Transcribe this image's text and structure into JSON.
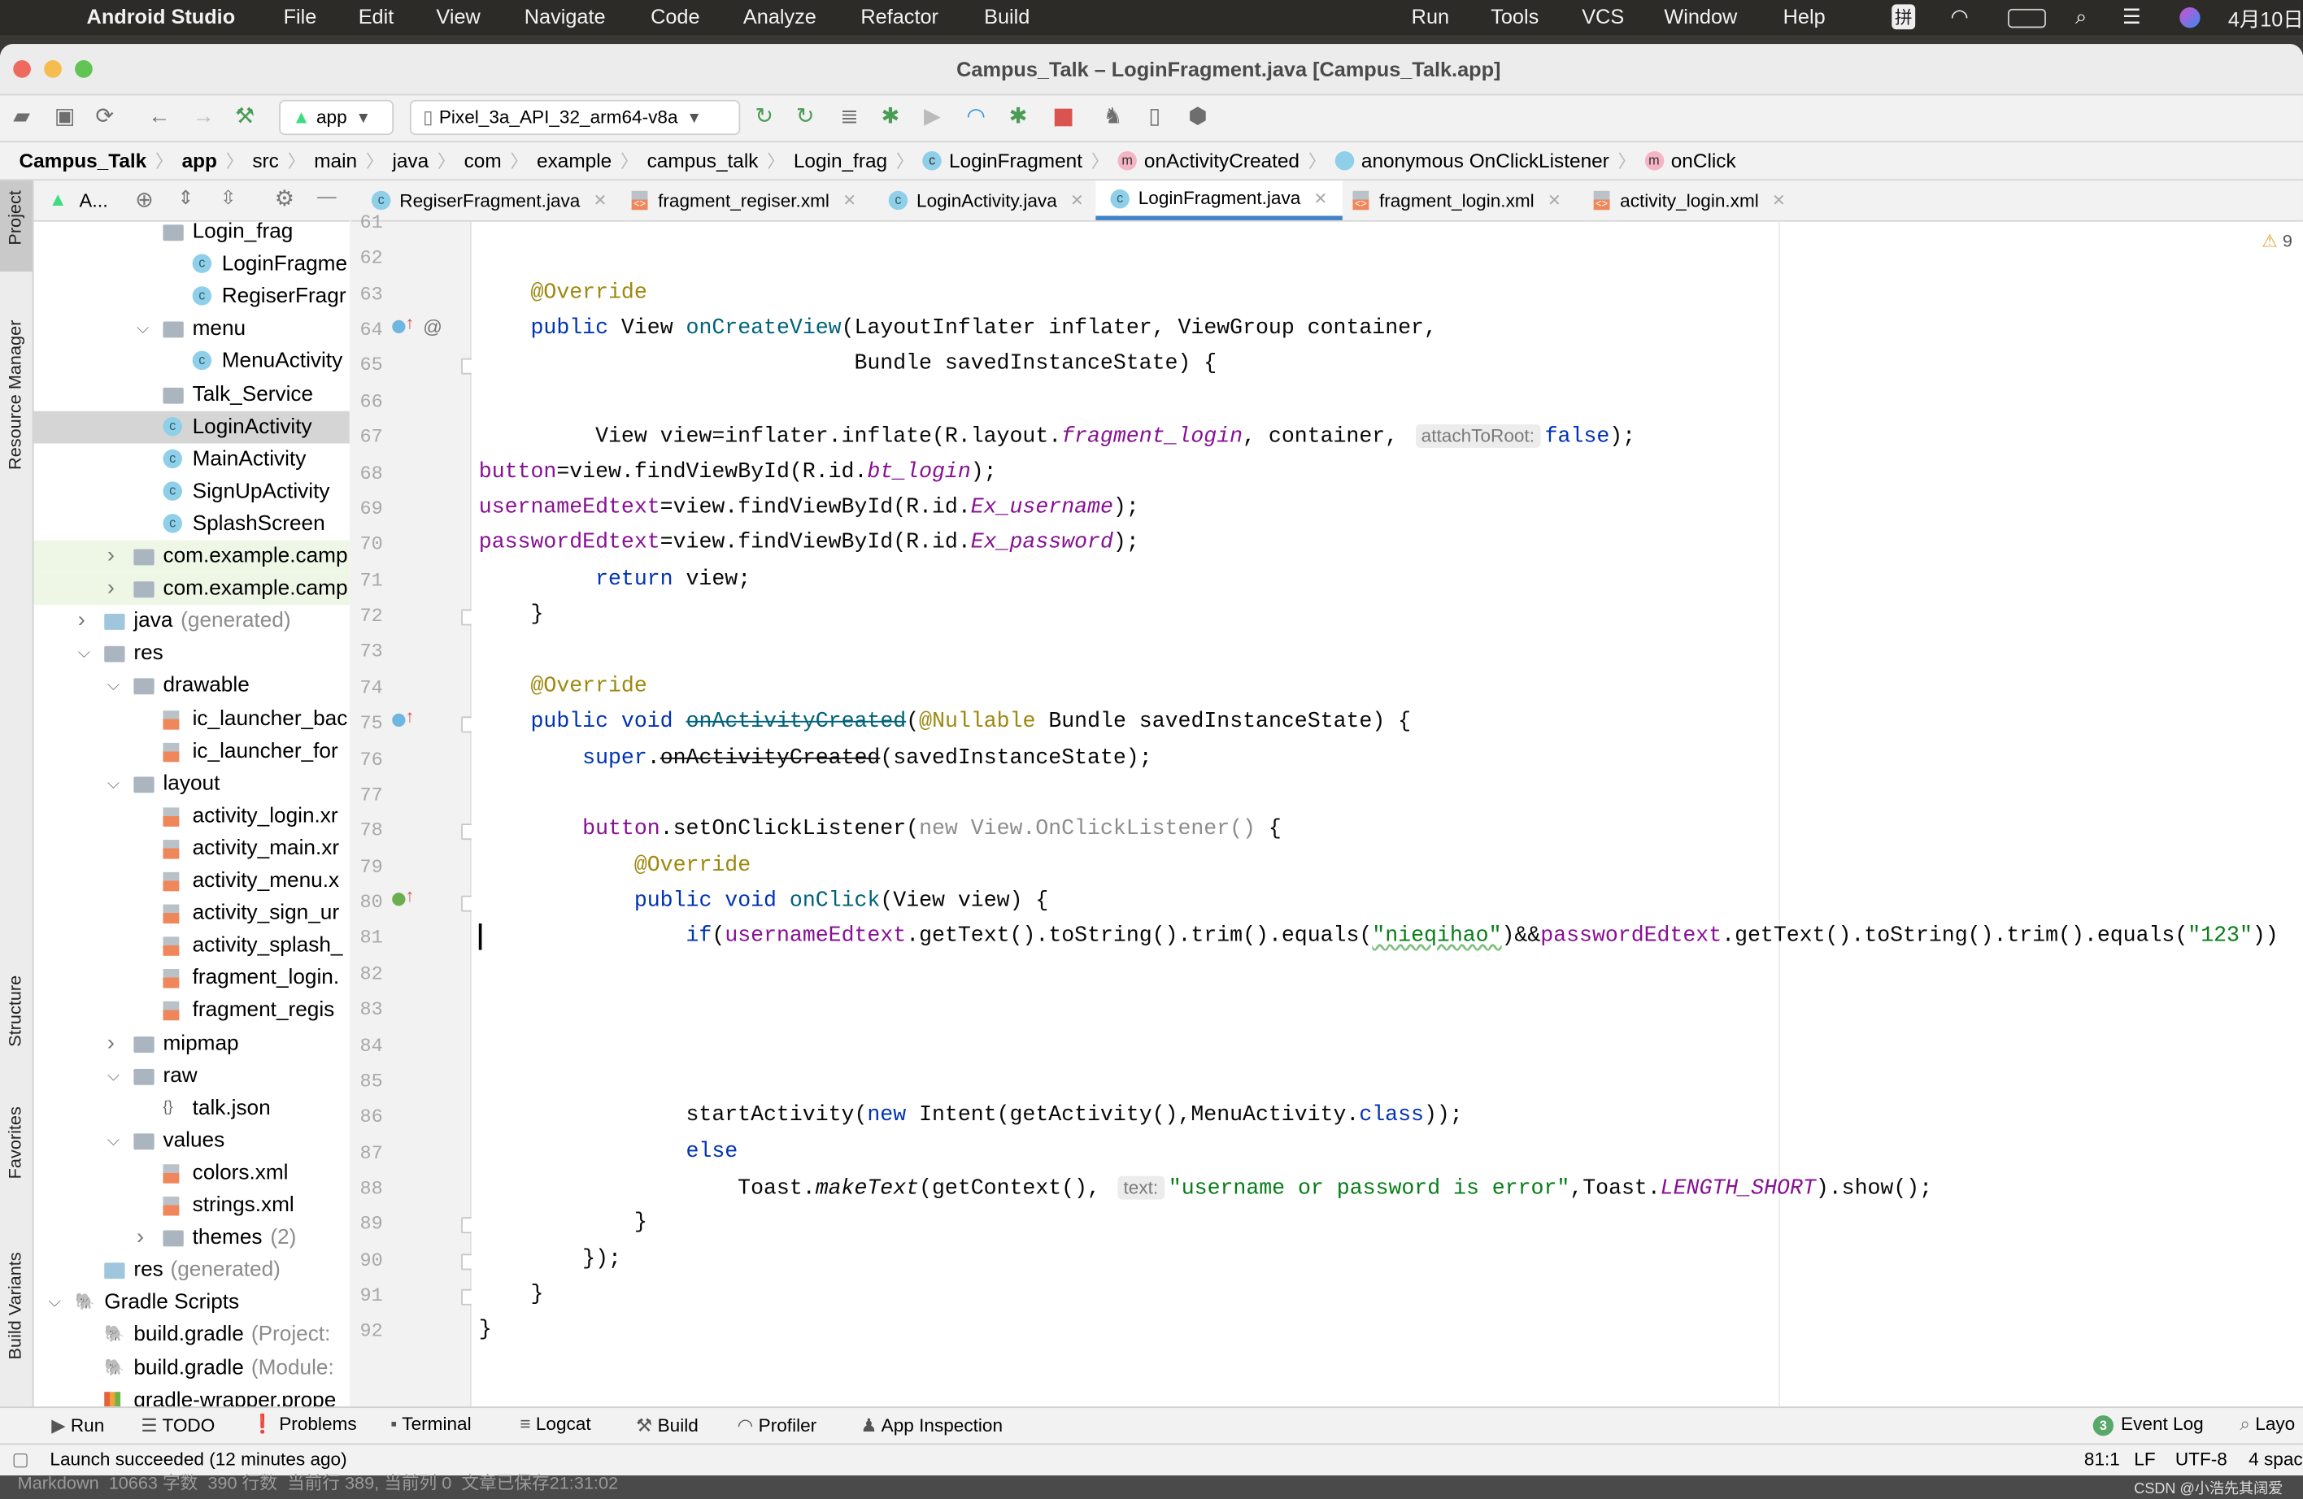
{
  "menubar": {
    "app_name": "Android Studio",
    "items": [
      "File",
      "Edit",
      "View",
      "Navigate",
      "Code",
      "Analyze",
      "Refactor",
      "Build",
      "Run",
      "Tools",
      "VCS",
      "Window",
      "Help"
    ],
    "ime": "拼",
    "clock": "4月10日"
  },
  "window": {
    "title": "Campus_Talk – LoginFragment.java [Campus_Talk.app]"
  },
  "toolbar": {
    "config": "app",
    "device": "Pixel_3a_API_32_arm64-v8a"
  },
  "breadcrumb": [
    {
      "label": "Campus_Talk",
      "bold": true
    },
    {
      "label": "app",
      "bold": true
    },
    {
      "label": "src"
    },
    {
      "label": "main"
    },
    {
      "label": "java"
    },
    {
      "label": "com"
    },
    {
      "label": "example"
    },
    {
      "label": "campus_talk"
    },
    {
      "label": "Login_frag"
    },
    {
      "label": "LoginFragment",
      "icon": "class-icon"
    },
    {
      "label": "onActivityCreated",
      "icon": "method-icon"
    },
    {
      "label": "anonymous OnClickListener",
      "icon": "anonymous-class-icon"
    },
    {
      "label": "onClick",
      "icon": "method-icon"
    }
  ],
  "project_panel": {
    "view_label": "A...",
    "strip_labels": [
      "Project",
      "Resource Manager",
      "Structure",
      "Favorites",
      "Build Variants"
    ]
  },
  "tabs": [
    {
      "label": "RegiserFragment.java",
      "type": "java",
      "active": false
    },
    {
      "label": "fragment_regiser.xml",
      "type": "xml",
      "active": false
    },
    {
      "label": "LoginActivity.java",
      "type": "java",
      "active": false
    },
    {
      "label": "LoginFragment.java",
      "type": "java",
      "active": true
    },
    {
      "label": "fragment_login.xml",
      "type": "xml",
      "active": false
    },
    {
      "label": "activity_login.xml",
      "type": "xml",
      "active": false
    }
  ],
  "tree": [
    {
      "label": "Login_frag",
      "level": 3,
      "icon": "folder"
    },
    {
      "label": "LoginFragme",
      "level": 4,
      "icon": "class"
    },
    {
      "label": "RegiserFragr",
      "level": 4,
      "icon": "class"
    },
    {
      "label": "menu",
      "level": 3,
      "icon": "folder",
      "chevron": "open"
    },
    {
      "label": "MenuActivity",
      "level": 4,
      "icon": "class"
    },
    {
      "label": "Talk_Service",
      "level": 3,
      "icon": "folder"
    },
    {
      "label": "LoginActivity",
      "level": 3,
      "icon": "class",
      "selected": true
    },
    {
      "label": "MainActivity",
      "level": 3,
      "icon": "class"
    },
    {
      "label": "SignUpActivity",
      "level": 3,
      "icon": "class"
    },
    {
      "label": "SplashScreen",
      "level": 3,
      "icon": "class"
    },
    {
      "label": "com.example.camp",
      "level": 2,
      "icon": "folder",
      "chevron": "closed",
      "test": true
    },
    {
      "label": "com.example.camp",
      "level": 2,
      "icon": "folder",
      "chevron": "closed",
      "test": true
    },
    {
      "label": "java",
      "suffix": "(generated)",
      "level": 1,
      "icon": "folder-gen",
      "chevron": "closed"
    },
    {
      "label": "res",
      "level": 1,
      "icon": "folder",
      "chevron": "open"
    },
    {
      "label": "drawable",
      "level": 2,
      "icon": "folder",
      "chevron": "open"
    },
    {
      "label": "ic_launcher_bac",
      "level": 3,
      "icon": "xml"
    },
    {
      "label": "ic_launcher_for",
      "level": 3,
      "icon": "xml"
    },
    {
      "label": "layout",
      "level": 2,
      "icon": "folder",
      "chevron": "open"
    },
    {
      "label": "activity_login.xr",
      "level": 3,
      "icon": "xml"
    },
    {
      "label": "activity_main.xr",
      "level": 3,
      "icon": "xml"
    },
    {
      "label": "activity_menu.x",
      "level": 3,
      "icon": "xml"
    },
    {
      "label": "activity_sign_ur",
      "level": 3,
      "icon": "xml"
    },
    {
      "label": "activity_splash_",
      "level": 3,
      "icon": "xml"
    },
    {
      "label": "fragment_login.",
      "level": 3,
      "icon": "xml"
    },
    {
      "label": "fragment_regis",
      "level": 3,
      "icon": "xml"
    },
    {
      "label": "mipmap",
      "level": 2,
      "icon": "folder",
      "chevron": "closed"
    },
    {
      "label": "raw",
      "level": 2,
      "icon": "folder",
      "chevron": "open"
    },
    {
      "label": "talk.json",
      "level": 3,
      "icon": "json"
    },
    {
      "label": "values",
      "level": 2,
      "icon": "folder",
      "chevron": "open"
    },
    {
      "label": "colors.xml",
      "level": 3,
      "icon": "xml"
    },
    {
      "label": "strings.xml",
      "level": 3,
      "icon": "xml"
    },
    {
      "label": "themes",
      "suffix": "(2)",
      "level": 3,
      "icon": "folder",
      "chevron": "closed"
    },
    {
      "label": "res",
      "suffix": "(generated)",
      "level": 1,
      "icon": "folder-gen"
    },
    {
      "label": "Gradle Scripts",
      "level": 0,
      "icon": "gradle",
      "chevron": "open"
    },
    {
      "label": "build.gradle",
      "suffix": "(Project:",
      "level": 1,
      "icon": "gradle"
    },
    {
      "label": "build.gradle",
      "suffix": "(Module:",
      "level": 1,
      "icon": "gradle"
    },
    {
      "label": "gradle-wrapper.prope",
      "level": 1,
      "icon": "properties"
    }
  ],
  "editor": {
    "warning_count": "9",
    "caret_line": 81,
    "lines": [
      {
        "n": 61,
        "t": []
      },
      {
        "n": 62,
        "t": []
      },
      {
        "n": 63,
        "t": [
          [
            "    ",
            ""
          ],
          [
            "@Override",
            "ann"
          ]
        ]
      },
      {
        "n": 64,
        "t": [
          [
            "    ",
            ""
          ],
          [
            "public",
            "kw"
          ],
          [
            " View ",
            ""
          ],
          [
            "onCreateView",
            "fn"
          ],
          [
            "(LayoutInflater inflater, ViewGroup container,",
            ""
          ]
        ],
        "marker": "override"
      },
      {
        "n": 65,
        "t": [
          [
            "                             Bundle savedInstanceState) {",
            ""
          ]
        ]
      },
      {
        "n": 66,
        "t": []
      },
      {
        "n": 67,
        "t": [
          [
            "         View view=inflater.inflate(R.layout.",
            ""
          ],
          [
            "fragment_login",
            "sfield"
          ],
          [
            ", container, ",
            ""
          ],
          [
            "attachToRoot:",
            "hint"
          ],
          [
            "false",
            "kw"
          ],
          [
            ");",
            ""
          ]
        ]
      },
      {
        "n": 68,
        "t": [
          [
            "button",
            "field"
          ],
          [
            "=view.findViewById(R.id.",
            ""
          ],
          [
            "bt_login",
            "sfield"
          ],
          [
            ");",
            ""
          ]
        ]
      },
      {
        "n": 69,
        "t": [
          [
            "usernameEdtext",
            "field"
          ],
          [
            "=view.findViewById(R.id.",
            ""
          ],
          [
            "Ex_username",
            "sfield"
          ],
          [
            ");",
            ""
          ]
        ]
      },
      {
        "n": 70,
        "t": [
          [
            "passwordEdtext",
            "field"
          ],
          [
            "=view.findViewById(R.id.",
            ""
          ],
          [
            "Ex_password",
            "sfield"
          ],
          [
            ");",
            ""
          ]
        ]
      },
      {
        "n": 71,
        "t": [
          [
            "         ",
            ""
          ],
          [
            "return",
            "kw"
          ],
          [
            " view;",
            ""
          ]
        ]
      },
      {
        "n": 72,
        "t": [
          [
            "    }",
            ""
          ]
        ]
      },
      {
        "n": 73,
        "t": []
      },
      {
        "n": 74,
        "t": [
          [
            "    ",
            ""
          ],
          [
            "@Override",
            "ann"
          ]
        ]
      },
      {
        "n": 75,
        "t": [
          [
            "    ",
            ""
          ],
          [
            "public void",
            "kw"
          ],
          [
            " ",
            ""
          ],
          [
            "onActivityCreated",
            "fnstrike"
          ],
          [
            "(",
            ""
          ],
          [
            "@Nullable",
            "ann"
          ],
          [
            " Bundle savedInstanceState) {",
            ""
          ]
        ],
        "marker": "override"
      },
      {
        "n": 76,
        "t": [
          [
            "        ",
            ""
          ],
          [
            "super",
            "kw"
          ],
          [
            ".",
            ""
          ],
          [
            "onActivityCreated",
            "strike"
          ],
          [
            "(savedInstanceState);",
            ""
          ]
        ]
      },
      {
        "n": 77,
        "t": []
      },
      {
        "n": 78,
        "t": [
          [
            "        ",
            ""
          ],
          [
            "button",
            "field"
          ],
          [
            ".setOnClickListener(",
            ""
          ],
          [
            "new View.OnClickListener()",
            "dim"
          ],
          [
            " {",
            ""
          ]
        ]
      },
      {
        "n": 79,
        "t": [
          [
            "            ",
            ""
          ],
          [
            "@Override",
            "ann"
          ]
        ]
      },
      {
        "n": 80,
        "t": [
          [
            "            ",
            ""
          ],
          [
            "public void",
            "kw"
          ],
          [
            " ",
            ""
          ],
          [
            "onClick",
            "fn"
          ],
          [
            "(View view) {",
            ""
          ]
        ],
        "marker": "implements"
      },
      {
        "n": 81,
        "t": [
          [
            "                ",
            ""
          ],
          [
            "if",
            "kw"
          ],
          [
            "(",
            ""
          ],
          [
            "usernameEdtext",
            "field"
          ],
          [
            ".getText().toString().trim().equals(",
            ""
          ],
          [
            "\"nieqihao\"",
            "typo"
          ],
          [
            ")&&",
            ""
          ],
          [
            "passwordEdtext",
            "field"
          ],
          [
            ".getText().toString().trim().equals(",
            ""
          ],
          [
            "\"123\"",
            "str"
          ],
          [
            "))",
            ""
          ]
        ]
      },
      {
        "n": 82,
        "t": []
      },
      {
        "n": 83,
        "t": []
      },
      {
        "n": 84,
        "t": []
      },
      {
        "n": 85,
        "t": []
      },
      {
        "n": 86,
        "t": [
          [
            "                startActivity(",
            ""
          ],
          [
            "new",
            "kw"
          ],
          [
            " Intent(getActivity(),MenuActivity.",
            ""
          ],
          [
            "class",
            "kw"
          ],
          [
            "));",
            ""
          ]
        ]
      },
      {
        "n": 87,
        "t": [
          [
            "                ",
            ""
          ],
          [
            "else",
            "kw"
          ]
        ]
      },
      {
        "n": 88,
        "t": [
          [
            "                    Toast.",
            ""
          ],
          [
            "makeText",
            "ital"
          ],
          [
            "(getContext(), ",
            ""
          ],
          [
            "text:",
            "hint"
          ],
          [
            "\"username or password is error\"",
            "str"
          ],
          [
            ",Toast.",
            ""
          ],
          [
            "LENGTH_SHORT",
            "sfield"
          ],
          [
            ").show();",
            ""
          ]
        ]
      },
      {
        "n": 89,
        "t": [
          [
            "            }",
            ""
          ]
        ]
      },
      {
        "n": 90,
        "t": [
          [
            "        });",
            ""
          ]
        ]
      },
      {
        "n": 91,
        "t": [
          [
            "    }",
            ""
          ]
        ]
      },
      {
        "n": 92,
        "t": [
          [
            "}",
            ""
          ]
        ]
      }
    ]
  },
  "bottom_tools": {
    "left": [
      "Run",
      "TODO",
      "Problems",
      "Terminal",
      "Logcat",
      "Build",
      "Profiler",
      "App Inspection"
    ],
    "event_log": "Event Log",
    "event_count": "3",
    "layout": "Layo"
  },
  "status": {
    "message": "Launch succeeded (12 minutes ago)",
    "position": "81:1",
    "line_sep": "LF",
    "encoding": "UTF-8",
    "indent": "4 spac"
  },
  "overlay": {
    "editor_stats": "Markdown  10663 字数  390 行数  当前行 389, 当前列 0  文章已保存21:31:02",
    "watermark": "CSDN @小浩先其阔爱"
  },
  "colors": {
    "keyword": "#0033b3",
    "string": "#067d17",
    "field": "#871094",
    "annotation": "#9e880d",
    "method": "#00627a",
    "accent": "#4083c9"
  }
}
